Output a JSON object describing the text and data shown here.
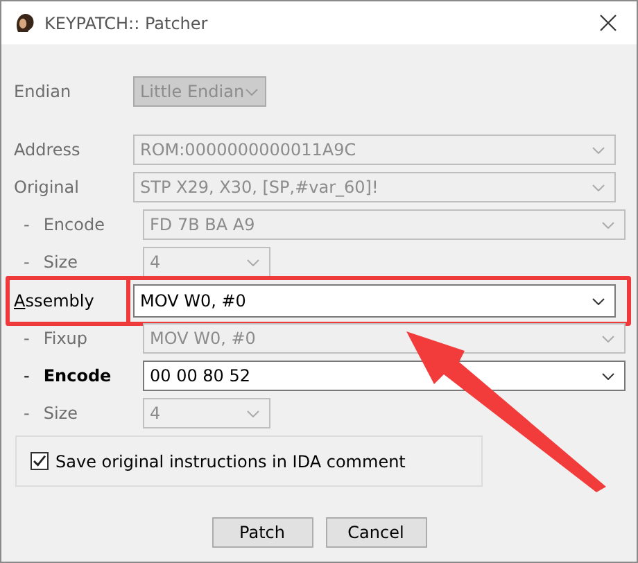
{
  "window": {
    "title": "KEYPATCH:: Patcher"
  },
  "endian": {
    "label": "Endian",
    "value": "Little Endian",
    "enabled": false
  },
  "rows": [
    {
      "label": "Address",
      "sub": false,
      "enabled": false,
      "kind": "full",
      "value": "ROM:0000000000011A9C",
      "highlighted": false
    },
    {
      "label": "Original",
      "sub": false,
      "enabled": false,
      "kind": "full",
      "value": "STP X29, X30, [SP,#var_60]!",
      "highlighted": false
    },
    {
      "label": "Encode",
      "sub": true,
      "enabled": false,
      "kind": "full",
      "value": "FD 7B BA A9",
      "highlighted": false
    },
    {
      "label": "Size",
      "sub": true,
      "enabled": false,
      "kind": "short",
      "value": "4",
      "highlighted": false
    },
    {
      "label": "Assembly",
      "sub": false,
      "enabled": true,
      "kind": "full",
      "value": "MOV W0, #0",
      "highlighted": true
    },
    {
      "label": "Fixup",
      "sub": true,
      "enabled": false,
      "kind": "full",
      "value": "MOV W0, #0",
      "highlighted": false
    },
    {
      "label": "Encode",
      "sub": true,
      "enabled": true,
      "kind": "full",
      "value": "00 00 80 52",
      "highlighted": false
    },
    {
      "label": "Size",
      "sub": true,
      "enabled": false,
      "kind": "short",
      "value": "4",
      "highlighted": false
    }
  ],
  "sub_marker": "-",
  "save_comment": {
    "label": "Save original instructions in IDA comment",
    "checked": true
  },
  "buttons": [
    "Patch",
    "Cancel"
  ]
}
